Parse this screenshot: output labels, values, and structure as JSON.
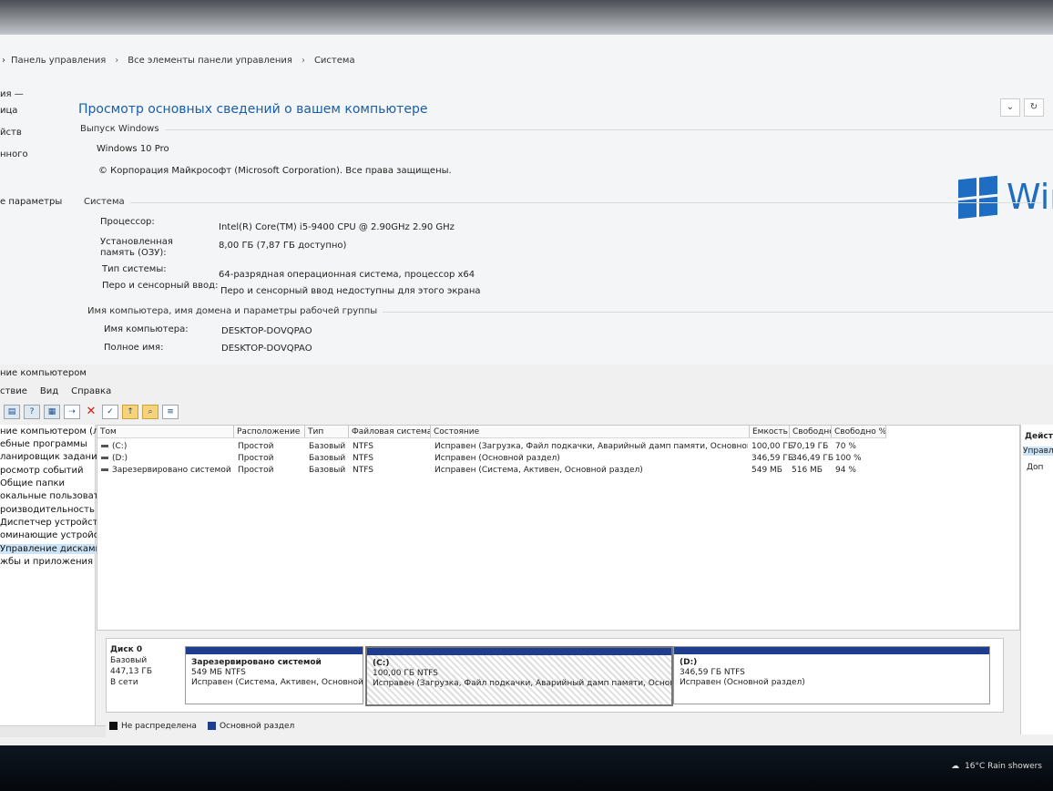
{
  "breadcrumb": [
    "Панель управления",
    "Все элементы панели управления",
    "Система"
  ],
  "left_nav": [
    "ия —",
    "ица",
    "йств",
    "нного",
    "е параметры"
  ],
  "page_title": "Просмотр основных сведений о вашем компьютере",
  "edition": {
    "heading": "Выпуск Windows",
    "name": "Windows 10 Pro",
    "copyright": "© Корпорация Майкрософт (Microsoft Corporation). Все права защищены."
  },
  "logo_text": "Wir",
  "system": {
    "heading": "Система",
    "rows": [
      {
        "label": "Процессор:",
        "value": "Intel(R) Core(TM) i5-9400 CPU @ 2.90GHz   2.90 GHz"
      },
      {
        "label": "Установленная память (ОЗУ):",
        "value": "8,00 ГБ (7,87 ГБ доступно)"
      },
      {
        "label": "Тип системы:",
        "value": "64-разрядная операционная система, процессор x64"
      },
      {
        "label": "Перо и сенсорный ввод:",
        "value": "Перо и сенсорный ввод недоступны для этого экрана"
      }
    ]
  },
  "computer_name": {
    "heading": "Имя компьютера, имя домена и параметры рабочей группы",
    "rows": [
      {
        "label": "Имя компьютера:",
        "value": "DESKTOP-DOVQPAO"
      },
      {
        "label": "Полное имя:",
        "value": "DESKTOP-DOVQPAO"
      }
    ]
  },
  "mmc": {
    "title": "ние компьютером",
    "menu": [
      "ствие",
      "Вид",
      "Справка"
    ],
    "tree": [
      "ние компьютером (л",
      "ебные программы",
      "ланировщик заданий",
      "росмотр событий",
      "Общие папки",
      "окальные пользовате",
      "роизводительность",
      "Диспетчер устройств",
      "оминающие устройст",
      "Управление дисками",
      "жбы и приложения"
    ],
    "columns": [
      "Том",
      "Расположение",
      "Тип",
      "Файловая система",
      "Состояние",
      "Емкость",
      "Свободно",
      "Свободно %"
    ],
    "rows": [
      [
        "(C:)",
        "Простой",
        "Базовый",
        "NTFS",
        "Исправен (Загрузка, Файл подкачки, Аварийный дамп памяти, Основной раздел)",
        "100,00 ГБ",
        "70,19 ГБ",
        "70 %"
      ],
      [
        "(D:)",
        "Простой",
        "Базовый",
        "NTFS",
        "Исправен (Основной раздел)",
        "346,59 ГБ",
        "346,49 ГБ",
        "100 %"
      ],
      [
        "Зарезервировано системой",
        "Простой",
        "Базовый",
        "NTFS",
        "Исправен (Система, Активен, Основной раздел)",
        "549 МБ",
        "516 МБ",
        "94 %"
      ]
    ],
    "actions": {
      "heading": "Действ",
      "selected": "Управле",
      "more": "Доп"
    },
    "disk": {
      "name": "Диск 0",
      "type": "Базовый",
      "size": "447,13 ГБ",
      "status": "В сети",
      "partitions": [
        {
          "title": "Зарезервировано системой",
          "size": "549 МБ NTFS",
          "state": "Исправен (Система, Активен, Основной р"
        },
        {
          "title": "(C:)",
          "size": "100,00 ГБ NTFS",
          "state": "Исправен (Загрузка, Файл подкачки, Аварийный дамп памяти, Основной разде"
        },
        {
          "title": "(D:)",
          "size": "346,59 ГБ NTFS",
          "state": "Исправен (Основной раздел)"
        }
      ]
    },
    "legend": [
      {
        "label": "Не распределена",
        "color": "#111111"
      },
      {
        "label": "Основной раздел",
        "color": "#1f3d8f"
      }
    ]
  },
  "taskbar": {
    "weather": "16°C  Rain showers"
  }
}
